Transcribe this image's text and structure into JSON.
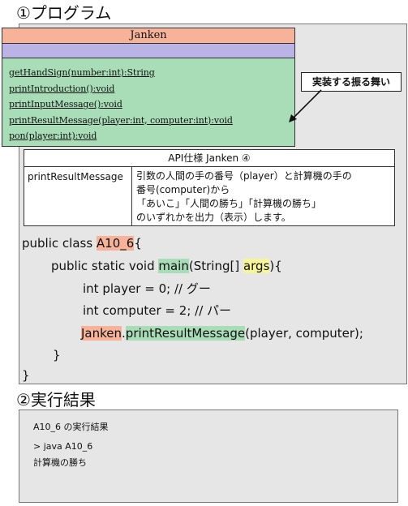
{
  "sections": {
    "program_title": "①プログラム",
    "result_title": "②実行結果"
  },
  "uml": {
    "class_name": "Janken",
    "methods": [
      "getHandSign(number:int):String",
      "printIntroduction():void",
      "printInputMessage():void",
      "printResultMessage(player:int, computer:int):void",
      "pon(player:int):void"
    ]
  },
  "callout": {
    "label": "実装する振る舞い"
  },
  "api": {
    "header": "API仕様 Janken ④",
    "method_name": "printResultMessage",
    "description_lines": [
      "引数の人間の手の番号（player）と計算機の手の",
      "番号(computer)から",
      "「あいこ」「人間の勝ち」「計算機の勝ち」",
      "のいずれかを出力（表示）します。"
    ]
  },
  "code": {
    "l1_pre": "public class ",
    "l1_class": "A10_6",
    "l1_post": "{",
    "l2_pre": "public static void ",
    "l2_main": "main",
    "l2_mid": "(String[] ",
    "l2_args": "args",
    "l2_post": "){",
    "l3": "int player = 0; // グー",
    "l4": "int computer = 2; // パー",
    "l5_obj": "Janken",
    "l5_dot": ".",
    "l5_method": "printResultMessage",
    "l5_post": "(player, computer);",
    "l6": "}",
    "l7": "}"
  },
  "result": {
    "heading": "A10_6 の実行結果",
    "command": "> java A10_6",
    "output": "計算機の勝ち"
  },
  "colors": {
    "class_header": "#f7b39a",
    "attributes_bg": "#b9b3e6",
    "methods_bg": "#a8ddb8",
    "highlight_red": "#f7b39a",
    "highlight_green": "#a8ddb8",
    "highlight_yellow": "#f7f59a",
    "panel_bg": "#e6e6e6"
  }
}
